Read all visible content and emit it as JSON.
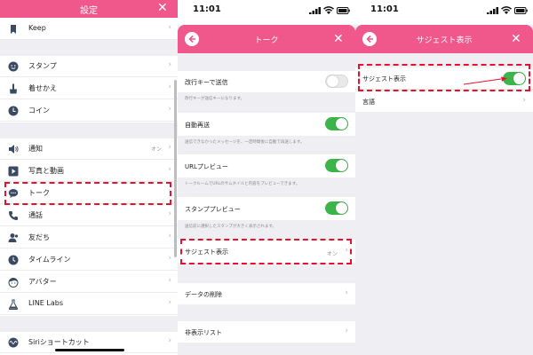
{
  "colors": {
    "accent": "#f0578a",
    "toggle_on": "#3bb54a",
    "highlight": "#e8102e"
  },
  "panel1": {
    "title": "設定",
    "items": {
      "keep": {
        "label": "Keep",
        "icon": "bookmark-icon"
      },
      "sticker": {
        "label": "スタンプ",
        "icon": "smiley-icon"
      },
      "theme": {
        "label": "着せかえ",
        "icon": "brush-icon"
      },
      "coin": {
        "label": "コイン",
        "icon": "coin-icon"
      },
      "notify": {
        "label": "通知",
        "value": "オン",
        "icon": "speaker-icon"
      },
      "photo": {
        "label": "写真と動画",
        "icon": "play-icon"
      },
      "talk": {
        "label": "トーク",
        "icon": "speech-bubble-icon"
      },
      "call": {
        "label": "通話",
        "icon": "phone-icon"
      },
      "friends": {
        "label": "友だち",
        "icon": "person-icon"
      },
      "timeline": {
        "label": "タイムライン",
        "icon": "clock-icon"
      },
      "avatar": {
        "label": "アバター",
        "icon": "avatar-face-icon"
      },
      "labs": {
        "label": "LINE Labs",
        "icon": "flask-icon"
      },
      "siri": {
        "label": "Siriショートカット",
        "icon": "siri-icon"
      }
    }
  },
  "panel2": {
    "time": "11:01",
    "title": "トーク",
    "rows": {
      "enter_send": {
        "label": "改行キーで送信",
        "desc": "改行キーが送信キーになります。",
        "on": false
      },
      "auto_resend": {
        "label": "自動再送",
        "desc": "送信できなかったメッセージを、一定時間後に自動で再送します。",
        "on": true
      },
      "url_preview": {
        "label": "URLプレビュー",
        "desc": "トークルームでURLのサムネイルと内容をプレビューできます。",
        "on": true
      },
      "sticker_preview": {
        "label": "スタンププレビュー",
        "desc": "送信前に選択したスタンプが大きく表示されます。",
        "on": true
      },
      "suggest": {
        "label": "サジェスト表示",
        "value": "オン"
      },
      "data_delete": {
        "label": "データの削除"
      },
      "hidden_list": {
        "label": "非表示リスト"
      }
    }
  },
  "panel3": {
    "time": "11:01",
    "title": "サジェスト表示",
    "rows": {
      "suggest": {
        "label": "サジェスト表示",
        "on": true
      },
      "language": {
        "label": "言語"
      }
    }
  }
}
